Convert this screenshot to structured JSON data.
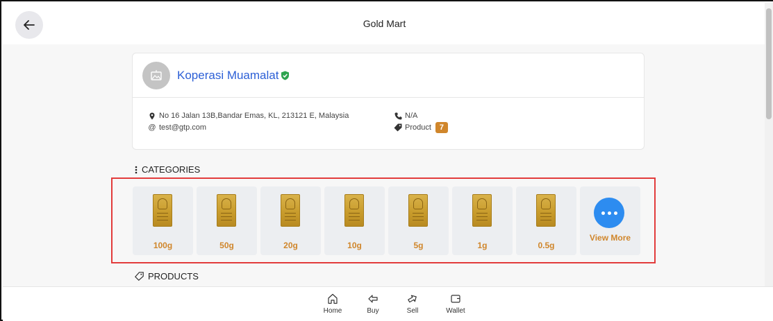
{
  "header": {
    "title": "Gold Mart"
  },
  "store": {
    "name": "Koperasi Muamalat",
    "address": "No 16 Jalan 13B,Bandar Emas, KL, 213121 E, Malaysia",
    "email": "test@gtp.com",
    "phone": "N/A",
    "product_label": "Product",
    "product_count": "7"
  },
  "sections": {
    "categories_label": "CATEGORIES",
    "products_label": "PRODUCTS"
  },
  "categories": [
    {
      "label": "100g"
    },
    {
      "label": "50g"
    },
    {
      "label": "20g"
    },
    {
      "label": "10g"
    },
    {
      "label": "5g"
    },
    {
      "label": "1g"
    },
    {
      "label": "0.5g"
    }
  ],
  "view_more_label": "View More",
  "bottom_nav": [
    {
      "label": "Home",
      "icon": "home-icon"
    },
    {
      "label": "Buy",
      "icon": "buy-icon"
    },
    {
      "label": "Sell",
      "icon": "sell-icon"
    },
    {
      "label": "Wallet",
      "icon": "wallet-icon"
    }
  ],
  "colors": {
    "accent_gold": "#d0862b",
    "link_blue": "#2c5fd6",
    "more_blue": "#2d8cf0",
    "verified_green": "#2ea44f",
    "highlight_red": "#e23b3b"
  }
}
